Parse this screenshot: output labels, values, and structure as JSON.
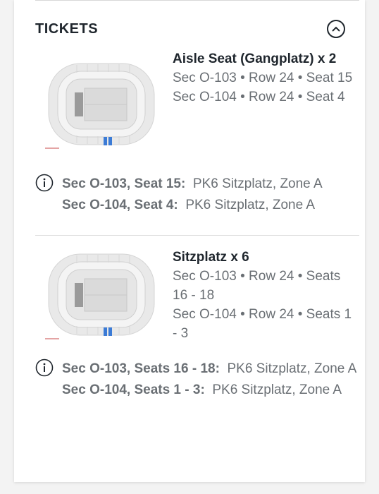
{
  "tickets_header": {
    "title": "TICKETS"
  },
  "tickets": [
    {
      "title": "Aisle Seat (Gangplatz) x 2",
      "seat_lines": [
        "Sec O-103 • Row 24 • Seat 15",
        "Sec O-104 • Row 24 • Seat 4"
      ],
      "info": [
        {
          "label": "Sec O-103, Seat 15:",
          "value": "PK6 Sitzplatz, Zone A"
        },
        {
          "label": "Sec O-104, Seat 4:",
          "value": "PK6 Sitzplatz, Zone A"
        }
      ]
    },
    {
      "title": "Sitzplatz x 6",
      "seat_lines": [
        "Sec O-103 • Row 24 • Seats 16 - 18",
        "Sec O-104 • Row 24 • Seats 1 - 3"
      ],
      "info": [
        {
          "label": "Sec O-103, Seats 16 - 18:",
          "value": "PK6 Sitzplatz, Zone A"
        },
        {
          "label": "Sec O-104, Seats 1 - 3:",
          "value": "PK6 Sitzplatz, Zone A"
        }
      ]
    }
  ],
  "icons": {
    "collapse": "chevron-up-icon",
    "info": "info-icon",
    "map": "stadium-map-icon"
  },
  "colors": {
    "highlight_section": "#3b7bd6",
    "stage": "#9a9a9a",
    "text": "#1f262d",
    "muted": "#6a6f74"
  }
}
